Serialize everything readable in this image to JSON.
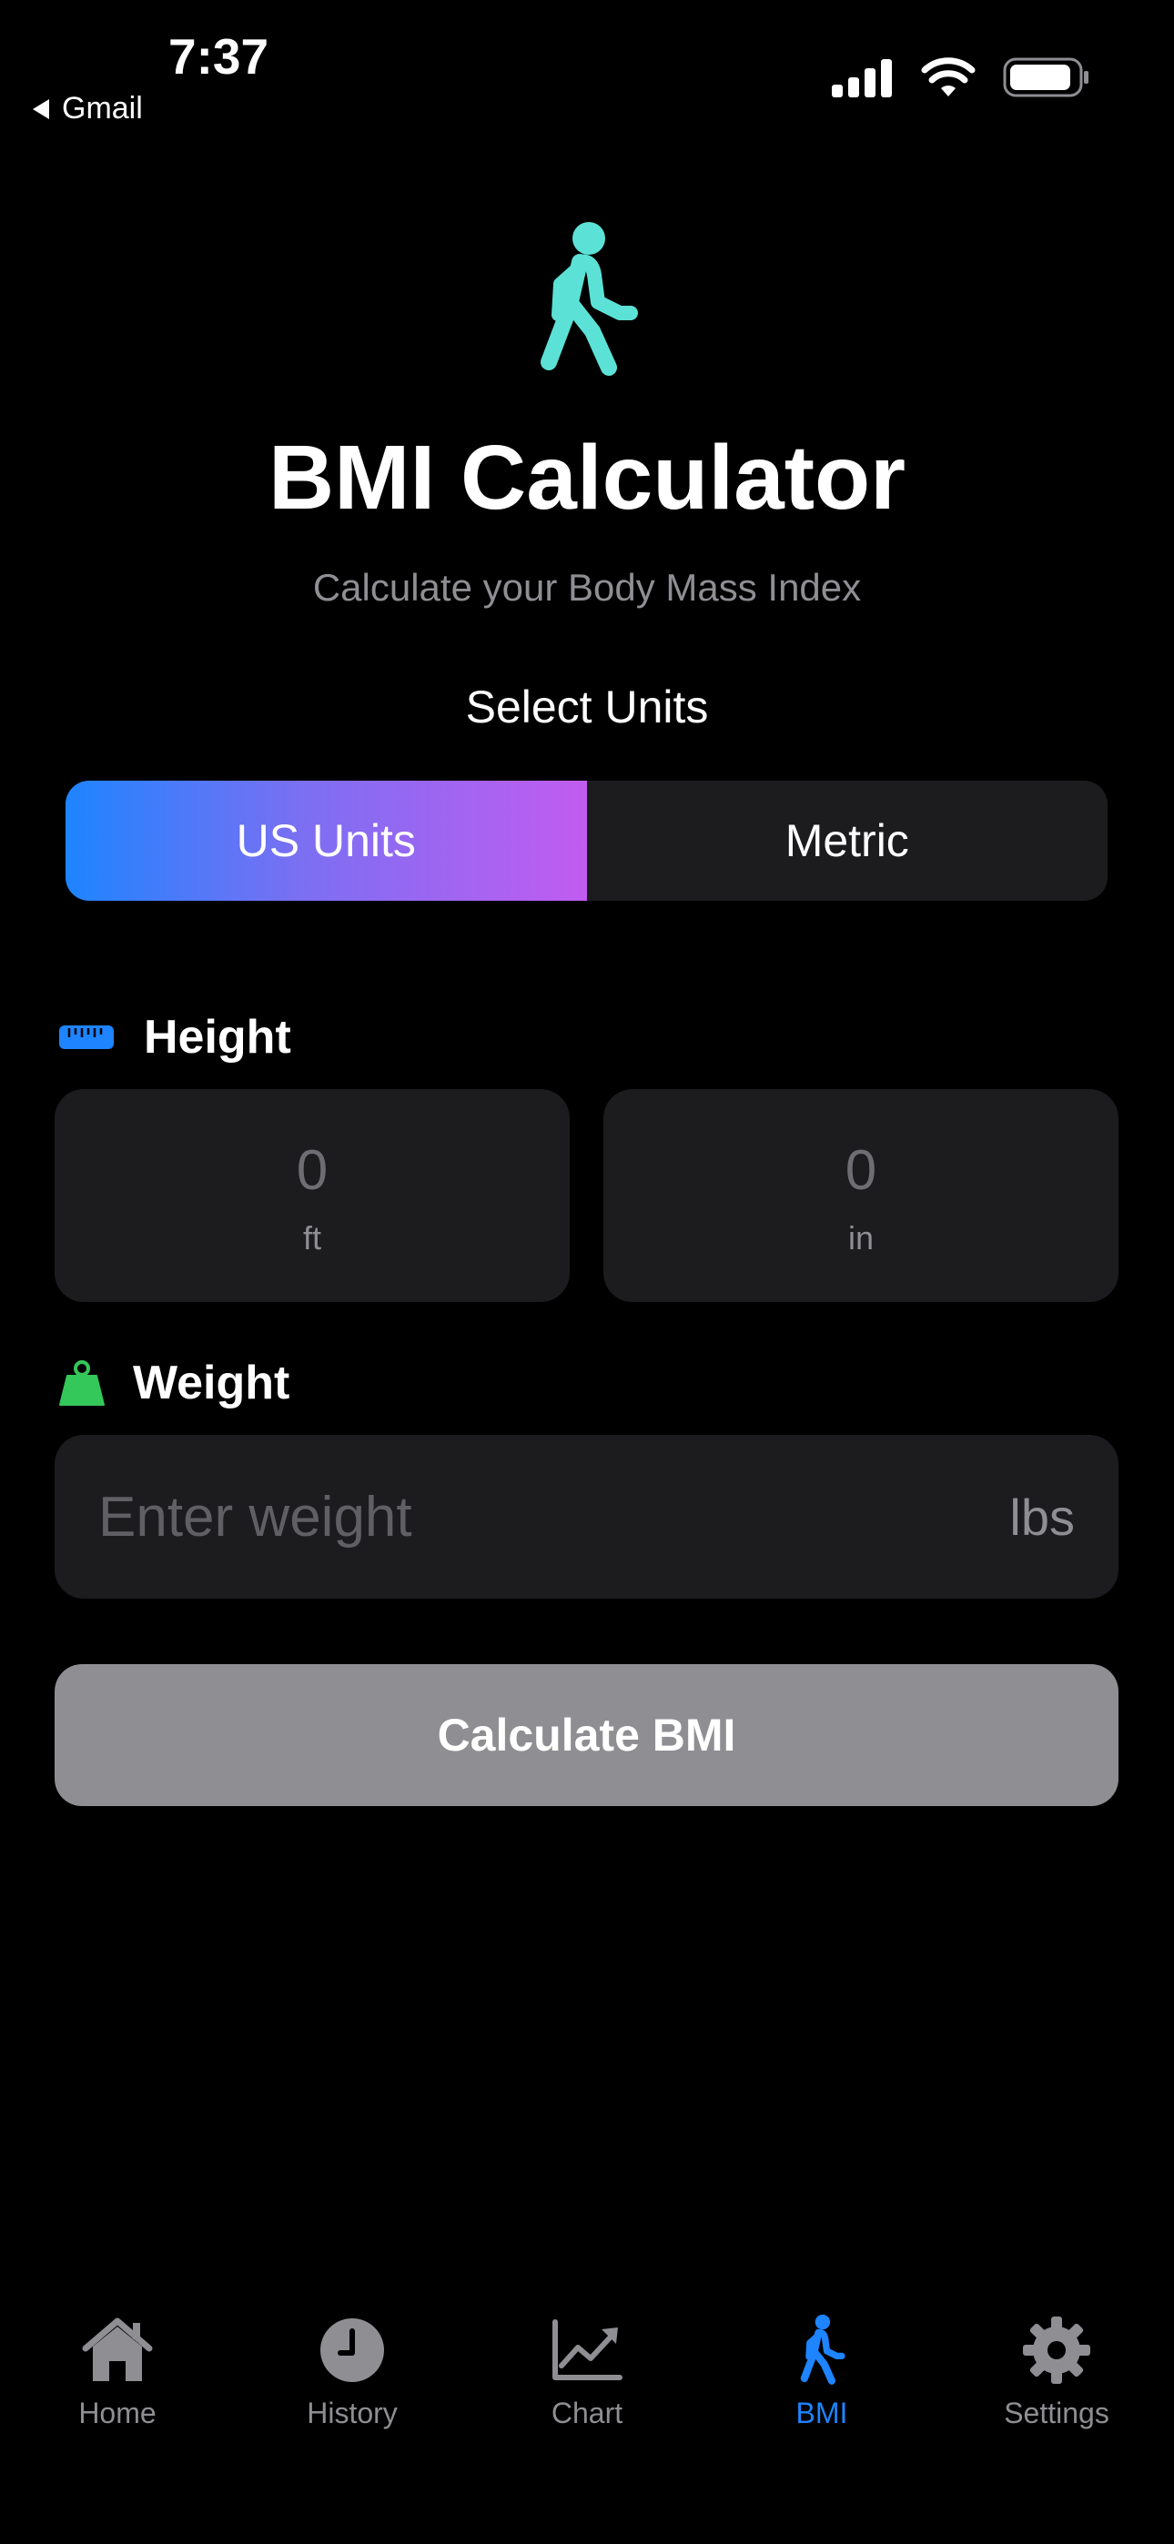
{
  "status_bar": {
    "time": "7:37",
    "back_app": "Gmail"
  },
  "header": {
    "icon": "figure-walk-icon",
    "title": "BMI Calculator",
    "subtitle": "Calculate your Body Mass Index"
  },
  "units": {
    "label": "Select Units",
    "options": [
      {
        "label": "US Units",
        "selected": true
      },
      {
        "label": "Metric",
        "selected": false
      }
    ]
  },
  "height": {
    "icon": "ruler-icon",
    "label": "Height",
    "feet": {
      "value": "0",
      "unit": "ft"
    },
    "inches": {
      "value": "0",
      "unit": "in"
    }
  },
  "weight": {
    "icon": "weight-icon",
    "label": "Weight",
    "placeholder": "Enter weight",
    "unit": "lbs"
  },
  "calculate_button": "Calculate BMI",
  "tab_bar": {
    "items": [
      {
        "label": "Home",
        "icon": "house-icon",
        "active": false
      },
      {
        "label": "History",
        "icon": "clock-icon",
        "active": false
      },
      {
        "label": "Chart",
        "icon": "chart-line-icon",
        "active": false
      },
      {
        "label": "BMI",
        "icon": "figure-walk-icon",
        "active": true
      },
      {
        "label": "Settings",
        "icon": "gear-icon",
        "active": false
      }
    ]
  },
  "colors": {
    "accent": "#1e84ff",
    "hero_icon": "#5ce1d6",
    "gradient_start": "#1e84ff",
    "gradient_end": "#c15cf0",
    "weight_icon": "#34c759",
    "card_bg": "#1c1c1e",
    "button_disabled": "#8e8e93"
  }
}
